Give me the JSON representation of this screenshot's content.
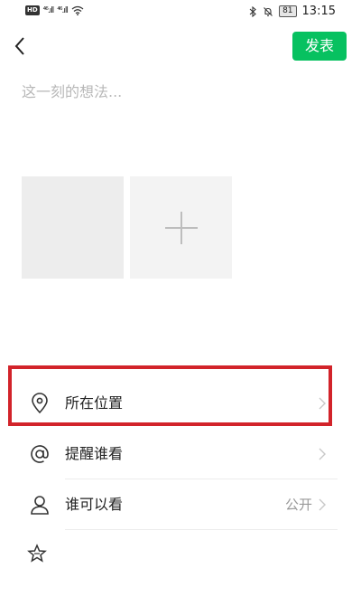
{
  "status_bar": {
    "hd_badge": "HD",
    "signal_1": "⁴⁶.ıll",
    "signal_2": "⁴⁶.ıll",
    "battery": "81",
    "time": "13:15"
  },
  "header": {
    "back_icon": "chevron-left-icon",
    "publish_label": "发表"
  },
  "compose": {
    "placeholder": "这一刻的想法...",
    "value": ""
  },
  "photos": {
    "add_icon": "plus-icon"
  },
  "options": [
    {
      "icon": "location-pin-icon",
      "label": "所在位置",
      "value": ""
    },
    {
      "icon": "at-sign-icon",
      "label": "提醒谁看",
      "value": ""
    },
    {
      "icon": "person-icon",
      "label": "谁可以看",
      "value": "公开"
    }
  ],
  "colors": {
    "accent_green": "#07c160",
    "highlight_red": "#d2232a",
    "placeholder_gray": "#b8b8b8"
  }
}
